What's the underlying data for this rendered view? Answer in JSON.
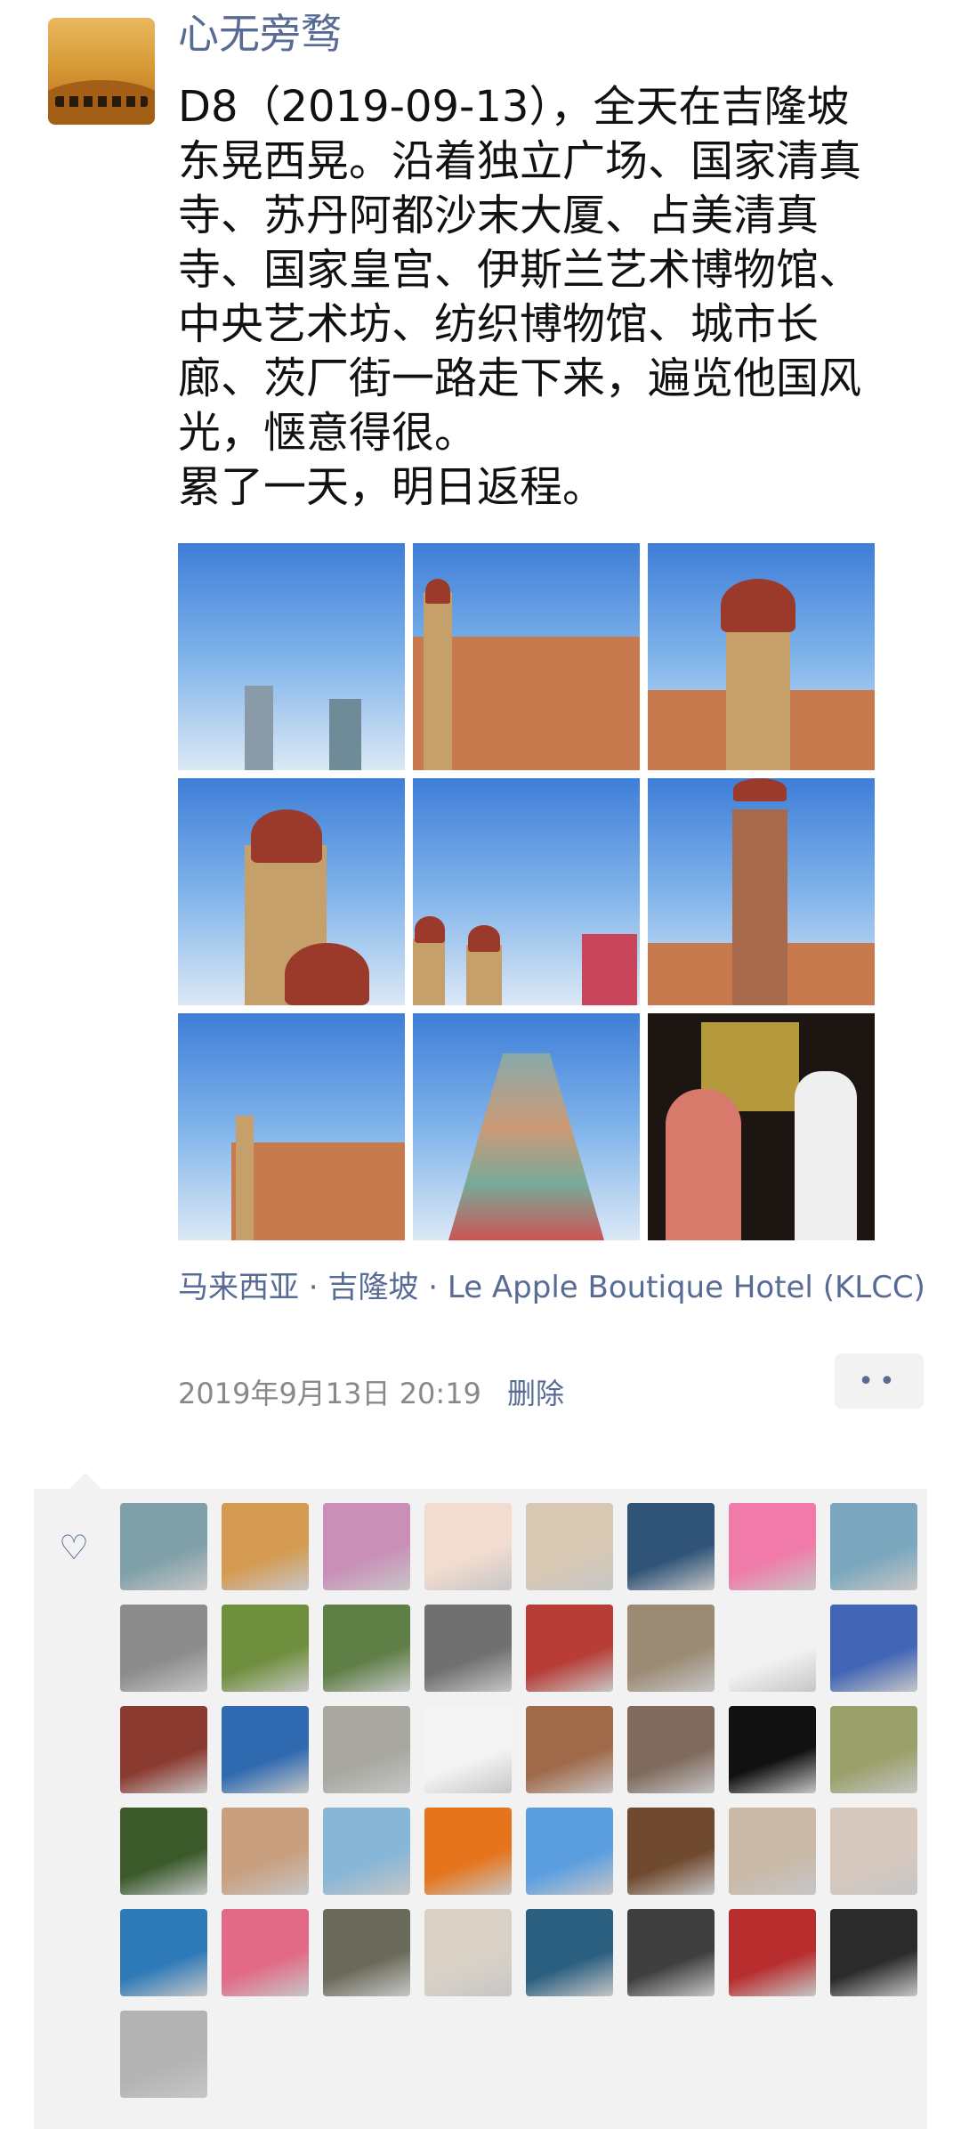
{
  "post": {
    "author": "心无旁骛",
    "text": "D8（2019-09-13），全天在吉隆坡\n东晃西晃。沿着独立广场、国家清真\n寺、苏丹阿都沙末大厦、占美清真\n寺、国家皇宫、伊斯兰艺术博物馆、\n中央艺术坊、纺织博物馆、城市长\n廊、茨厂街一路走下来，遍览他国风\n光，惬意得很。\n累了一天，明日返程。",
    "location": "马来西亚 · 吉隆坡 · Le Apple Boutique Hotel (KLCC)",
    "time": "2019年9月13日 20:19",
    "delete_label": "删除",
    "more_label": "••"
  },
  "icons": {
    "like": "heart-outline-icon",
    "more": "more-dots-icon"
  },
  "colors": {
    "link": "#576b95",
    "panel": "#f2f2f2"
  },
  "likes": {
    "heart_glyph": "♡",
    "avatar_colors": [
      "#7fa0a8",
      "#d59a52",
      "#c98fb7",
      "#f1dccf",
      "#d9c9b4",
      "#2f5477",
      "#f07aa8",
      "#7aa7bd",
      "#8c8c8c",
      "#6f8f3e",
      "#5f7f47",
      "#707070",
      "#b73d36",
      "#9c8b74",
      "#f2f2f2",
      "#4265b5",
      "#8a3a2f",
      "#2f6ab0",
      "#a8a8a0",
      "#f4f4f4",
      "#a06a4a",
      "#7f6a5d",
      "#111111",
      "#9aa06a",
      "#3a5a2a",
      "#c8a080",
      "#87b6d6",
      "#e6741c",
      "#5a9ee0",
      "#6f4a2e",
      "#c9b9a6",
      "#d7c8be",
      "#2e7ab8",
      "#e26a86",
      "#6a6a5a",
      "#d9d1c6",
      "#2a5f7f",
      "#3f3f3f",
      "#b82d2d",
      "#2b2b2b",
      "#b3b3b3"
    ]
  }
}
